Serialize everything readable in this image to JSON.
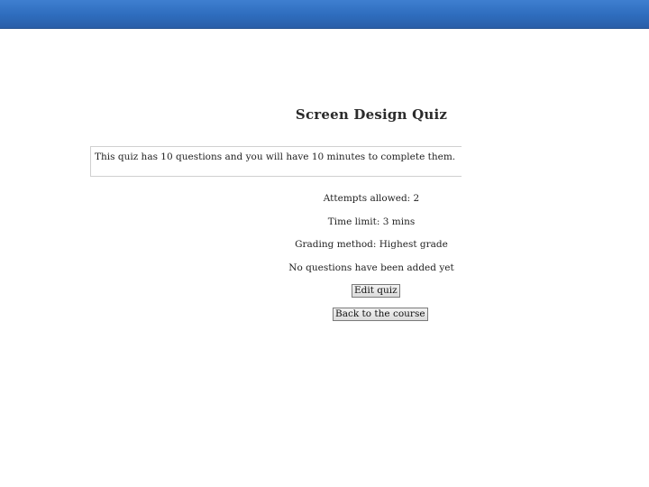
{
  "quiz": {
    "title": "Screen Design Quiz",
    "intro": "This quiz has 10 questions and you will have 10 minutes to complete them.",
    "attempts": "Attempts allowed: 2",
    "time_limit": "Time limit: 3 mins",
    "grading": "Grading method: Highest grade",
    "no_questions": "No questions have been added yet"
  },
  "buttons": {
    "edit_quiz": "Edit quiz",
    "back_to_course": "Back to the course"
  },
  "colors": {
    "header_bar": "#2e6cbd"
  }
}
